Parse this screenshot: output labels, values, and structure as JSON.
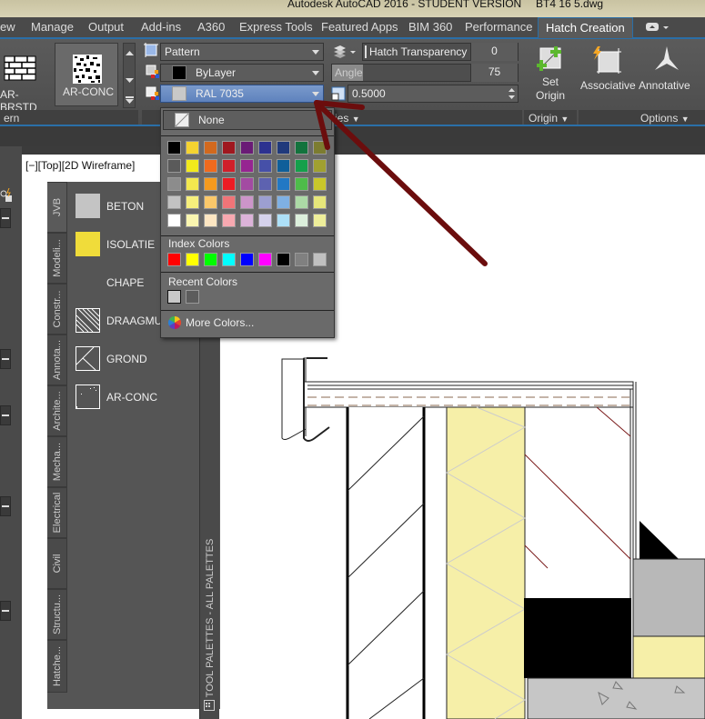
{
  "window": {
    "title": "Autodesk AutoCAD 2016 - STUDENT VERSION",
    "file": "BT4 16 5.dwg"
  },
  "ribbon_tabs": [
    {
      "label": "ew"
    },
    {
      "label": "Manage"
    },
    {
      "label": "Output"
    },
    {
      "label": "Add-ins"
    },
    {
      "label": "A360"
    },
    {
      "label": "Express Tools"
    },
    {
      "label": "Featured Apps"
    },
    {
      "label": "BIM 360"
    },
    {
      "label": "Performance"
    },
    {
      "label": "Hatch Creation",
      "active": true
    }
  ],
  "pattern_panel": {
    "items": [
      {
        "label": "AR-BRSTD"
      },
      {
        "label": "AR-CONC",
        "selected": true
      }
    ],
    "footer": "ern"
  },
  "properties_panel": {
    "hatch_type": "Pattern",
    "hatch_color": "ByLayer",
    "background_color": "RAL 7035",
    "transparency_label": "Hatch Transparency",
    "transparency_value": "0",
    "angle_label": "Angle",
    "angle_value": "75",
    "scale_value": "0.5000",
    "footer": "ies"
  },
  "origin_panel": {
    "button": "Set Origin",
    "button_line1": "Set",
    "button_line2": "Origin",
    "footer": "Origin"
  },
  "options_panel": {
    "associative": "Associative",
    "annotative": "Annotative",
    "footer": "Options"
  },
  "color_dropdown": {
    "none_label": "None",
    "palette_rows": [
      [
        "#000000",
        "#f5d330",
        "#d2691e",
        "#a0181f",
        "#6a1b76",
        "#2d3290",
        "#203a7c",
        "#13733d",
        "#7c7c30"
      ],
      [
        "#5a5a5a",
        "#f2ea1c",
        "#f06a1e",
        "#d0202a",
        "#962591",
        "#4650a8",
        "#0f5f9a",
        "#14a04b",
        "#a0a030"
      ],
      [
        "#8c8c8c",
        "#f3e84e",
        "#f69a1e",
        "#ec1c24",
        "#a34ba2",
        "#5d62b0",
        "#2278c4",
        "#4ebc4a",
        "#c9c72a"
      ],
      [
        "#c2c2c2",
        "#f6ef7c",
        "#fbc86a",
        "#f07478",
        "#cc95c9",
        "#9c9fd1",
        "#7fb0e3",
        "#acd9a6",
        "#e6e67a"
      ],
      [
        "#ffffff",
        "#faf6b0",
        "#fde6c2",
        "#f7a8b0",
        "#dcb3d9",
        "#d5d2ec",
        "#ade0f8",
        "#dcefdc",
        "#eeee9a"
      ]
    ],
    "index_label": "Index Colors",
    "index_colors": [
      "#ff0000",
      "#ffff00",
      "#00ff00",
      "#00ffff",
      "#0000ff",
      "#ff00ff",
      "#000000",
      "#808080",
      "#c0c0c0"
    ],
    "recent_label": "Recent Colors",
    "recent_colors": [
      "#c8c8c8",
      "#5c5c5c"
    ],
    "more_label": "More Colors..."
  },
  "viewport": {
    "label": "[−][Top][2D Wireframe]"
  },
  "tool_palette": {
    "title": "TOOL PALETTES - ALL PALETTES",
    "tabs": [
      "JVB",
      "Modeli...",
      "Constr...",
      "Annota...",
      "Archite...",
      "Mecha...",
      "Electrical",
      "Civil",
      "Structu...",
      "Hatche..."
    ],
    "items": [
      {
        "label": "BETON",
        "icon": "solid-gray-swatch",
        "color": "#c4c4c4"
      },
      {
        "label": "ISOLATIE",
        "icon": "solid-yellow-swatch",
        "color": "#f0dc3a"
      },
      {
        "label": "CHAPE",
        "icon": "none"
      },
      {
        "label": "DRAAGMU",
        "icon": "hatch-diagonal-icon"
      },
      {
        "label": "GROND",
        "icon": "hatch-ground-icon"
      },
      {
        "label": "AR-CONC",
        "icon": "hatch-concrete-icon"
      }
    ]
  }
}
